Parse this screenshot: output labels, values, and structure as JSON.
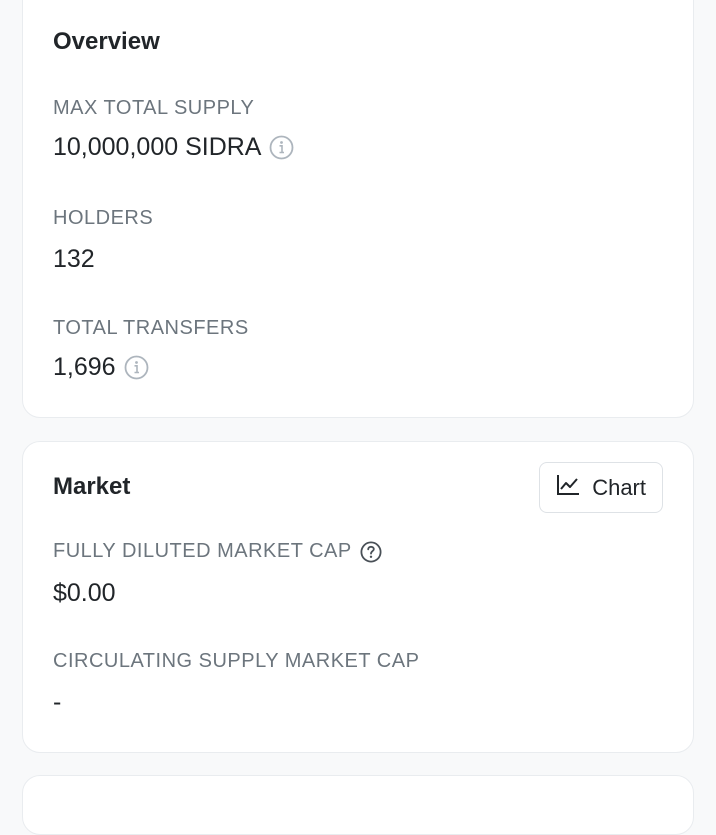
{
  "overview": {
    "title": "Overview",
    "max_supply_label": "MAX TOTAL SUPPLY",
    "max_supply_value": "10,000,000 SIDRA",
    "holders_label": "HOLDERS",
    "holders_value": "132",
    "transfers_label": "TOTAL TRANSFERS",
    "transfers_value": "1,696"
  },
  "market": {
    "title": "Market",
    "chart_button_label": "Chart",
    "fdmc_label": "FULLY DILUTED MARKET CAP",
    "fdmc_value": "$0.00",
    "csmc_label": "CIRCULATING SUPPLY MARKET CAP",
    "csmc_value": "-"
  },
  "icons": {
    "info": "info-icon",
    "help": "help-icon",
    "chart": "line-chart-icon"
  },
  "colors": {
    "background": "#f8f9fa",
    "card": "#ffffff",
    "label": "#6c757d",
    "value": "#212529",
    "border": "#e9ecef"
  }
}
